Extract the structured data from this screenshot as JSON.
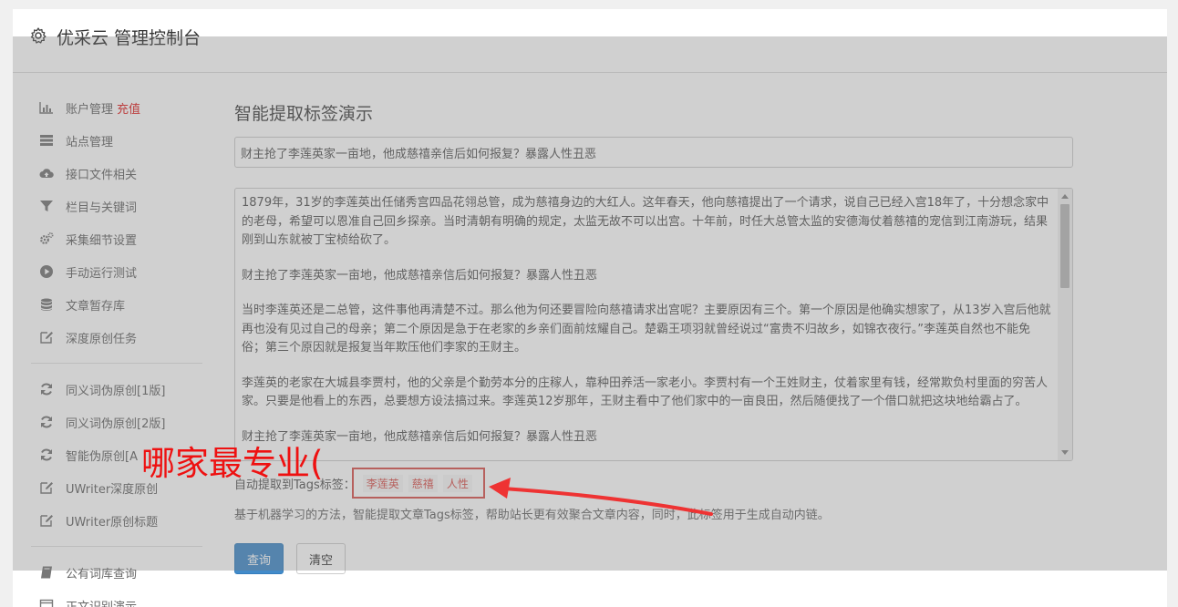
{
  "header": {
    "title": "优采云 管理控制台"
  },
  "sidebar": {
    "group1": [
      {
        "label": "账户管理",
        "extra": "充值",
        "icon": "bar-chart-icon"
      },
      {
        "label": "站点管理",
        "icon": "server-icon"
      },
      {
        "label": "接口文件相关",
        "icon": "cloud-upload-icon"
      },
      {
        "label": "栏目与关键词",
        "icon": "filter-icon"
      },
      {
        "label": "采集细节设置",
        "icon": "cogs-icon"
      },
      {
        "label": "手动运行测试",
        "icon": "play-icon"
      },
      {
        "label": "文章暂存库",
        "icon": "database-icon"
      },
      {
        "label": "深度原创任务",
        "icon": "edit-icon"
      }
    ],
    "group2": [
      {
        "label": "同义词伪原创[1版]",
        "icon": "refresh-icon"
      },
      {
        "label": "同义词伪原创[2版]",
        "icon": "refresh-icon"
      },
      {
        "label": "智能伪原创[A",
        "icon": "refresh-icon"
      },
      {
        "label": "UWriter深度原创",
        "icon": "edit-icon"
      },
      {
        "label": "UWriter原创标题",
        "icon": "edit-icon"
      }
    ],
    "group3": [
      {
        "label": "公有词库查询",
        "icon": "book-icon"
      },
      {
        "label": "正文识别演示",
        "icon": "window-icon"
      }
    ]
  },
  "main": {
    "page_title": "智能提取标签演示",
    "title_input_value": "财主抢了李莲英家一亩地，他成慈禧亲信后如何报复？暴露人性丑恶",
    "article_paragraphs": [
      "1879年，31岁的李莲英出任储秀宫四品花翎总管，成为慈禧身边的大红人。这年春天，他向慈禧提出了一个请求，说自己已经入宫18年了，十分想念家中的老母，希望可以恩准自己回乡探亲。当时清朝有明确的规定，太监无故不可以出宫。十年前，时任大总管太监的安德海仗着慈禧的宠信到江南游玩，结果刚到山东就被丁宝桢给砍了。",
      "财主抢了李莲英家一亩地，他成慈禧亲信后如何报复？暴露人性丑恶",
      "当时李莲英还是二总管，这件事他再清楚不过。那么他为何还要冒险向慈禧请求出宫呢？主要原因有三个。第一个原因是他确实想家了，从13岁入宫后他就再也没有见过自己的母亲；第二个原因是急于在老家的乡亲们面前炫耀自己。楚霸王项羽就曾经说过“富贵不归故乡，如锦衣夜行。”李莲英自然也不能免俗；第三个原因就是报复当年欺压他们李家的王财主。",
      "李莲英的老家在大城县李贾村，他的父亲是个勤劳本分的庄稼人，靠种田养活一家老小。李贾村有一个王姓财主，仗着家里有钱，经常欺负村里面的穷苦人家。只要是他看上的东西，总要想方设法搞过来。李莲英12岁那年，王财主看中了他们家中的一亩良田，然后随便找了一个借口就把这块地给霸占了。",
      "财主抢了李莲英家一亩地，他成慈禧亲信后如何报复？暴露人性丑恶"
    ],
    "tags_label": "自动提取到Tags标签：",
    "tags": [
      "李莲英",
      "慈禧",
      "人性"
    ],
    "description": "基于机器学习的方法，智能提取文章Tags标签，帮助站长更有效聚合文章内容，同时，此标签用于生成自动内链。",
    "query_button": "查询",
    "clear_button": "清空"
  },
  "annotation": {
    "text": "哪家最专业("
  },
  "colors": {
    "accent": "#428bca",
    "highlight": "#d9534f",
    "annotation": "#ee1111"
  }
}
